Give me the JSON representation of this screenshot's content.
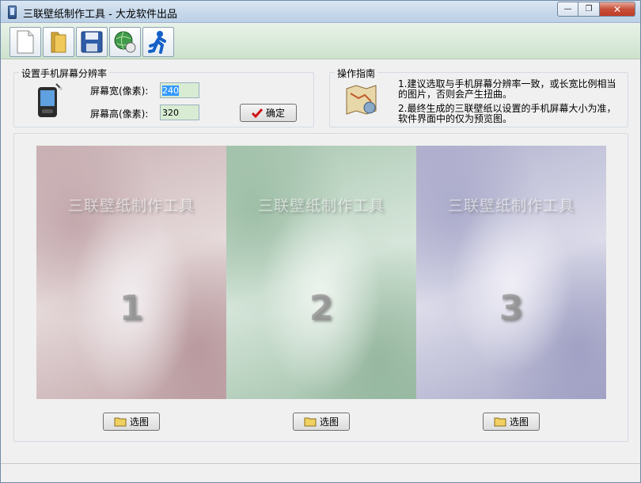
{
  "window": {
    "title": "三联壁纸制作工具 - 大龙软件出品",
    "minimize": "—",
    "restore": "❐",
    "close": "✕"
  },
  "toolbar": {
    "buttons": [
      {
        "name": "new-file-icon"
      },
      {
        "name": "open-folder-icon"
      },
      {
        "name": "save-icon"
      },
      {
        "name": "web-globe-icon"
      },
      {
        "name": "run-person-icon"
      }
    ]
  },
  "resolution": {
    "group_title": "设置手机屏幕分辨率",
    "width_label": "屏幕宽(像素):",
    "width_value": "240",
    "height_label": "屏幕高(像素):",
    "height_value": "320",
    "confirm_label": "确定",
    "icon": "mobile-phone-icon"
  },
  "guide": {
    "group_title": "操作指南",
    "line1": "1.建议选取与手机屏幕分辨率一致，或长宽比例相当的图片，否则会产生扭曲。",
    "line2": "2.最终生成的三联壁纸以设置的手机屏幕大小为准，软件界面中的仅为预览图。",
    "icon": "map-guide-icon"
  },
  "preview": {
    "watermark": "三联壁纸制作工具",
    "panels": [
      {
        "number": "1",
        "button": "选图"
      },
      {
        "number": "2",
        "button": "选图"
      },
      {
        "number": "3",
        "button": "选图"
      }
    ]
  },
  "colors": {
    "titlebar": "#c6d8ea",
    "toolbar": "#cde2cd",
    "field_bg": "#d7ecd2"
  }
}
